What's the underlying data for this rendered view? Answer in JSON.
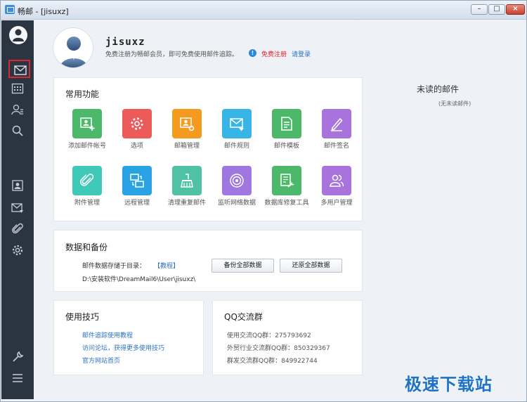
{
  "window": {
    "title": "畅邮 - [jisuxz]"
  },
  "profile": {
    "username": "jisuxz",
    "register_hint": "免费注册为畅邮会员，即可免费使用邮件追踪。",
    "info_glyph": "!",
    "free_register": "免费注册",
    "login": "请登录"
  },
  "functions": {
    "title": "常用功能",
    "items": [
      {
        "label": "添加邮件帐号",
        "icon": "add-account-icon",
        "color": "#4cb86a"
      },
      {
        "label": "选项",
        "icon": "settings-icon",
        "color": "#ec5a5a"
      },
      {
        "label": "邮箱管理",
        "icon": "mailbox-manage-icon",
        "color": "#f49a1e"
      },
      {
        "label": "邮件规则",
        "icon": "mail-rule-icon",
        "color": "#37b5e6"
      },
      {
        "label": "邮件模板",
        "icon": "template-icon",
        "color": "#4cb86a"
      },
      {
        "label": "邮件签名",
        "icon": "signature-icon",
        "color": "#a973dd"
      },
      {
        "label": "附件管理",
        "icon": "attachment-icon",
        "color": "#3fc9b8"
      },
      {
        "label": "远程管理",
        "icon": "remote-icon",
        "color": "#2aa3e4"
      },
      {
        "label": "清理重复邮件",
        "icon": "broom-icon",
        "color": "#4fc2a6"
      },
      {
        "label": "监听网络数据",
        "icon": "radar-icon",
        "color": "#9f77e0"
      },
      {
        "label": "数据库修复工具",
        "icon": "db-repair-icon",
        "color": "#4cb86a"
      },
      {
        "label": "多用户管理",
        "icon": "users-icon",
        "color": "#a973dd"
      }
    ]
  },
  "backup": {
    "title": "数据和备份",
    "storage_label": "邮件数据存储于目录：",
    "tutorial_link": "【教程】",
    "path": "D:\\安装软件\\DreamMail6\\User\\jisuxz\\",
    "backup_all": "备份全部数据",
    "restore_all": "还原全部数据"
  },
  "tips": {
    "title": "使用技巧",
    "links": [
      "邮件追踪使用教程",
      "访问论坛，获得更多使用技巧",
      "官方网站首页"
    ]
  },
  "qq": {
    "title": "QQ交流群",
    "lines": [
      "使用交流QQ群：275793692",
      "外贸行业交流群QQ群：850329367",
      "群发交流群QQ群：849922744"
    ]
  },
  "unread": {
    "title": "未读的邮件",
    "empty": "(无未读邮件)"
  },
  "watermark": "极速下载站",
  "colors": {
    "sidebar": "#2b3542",
    "accent_blue": "#2b72c2",
    "accent_red": "#e0232b",
    "active_outline": "#d8282f"
  }
}
